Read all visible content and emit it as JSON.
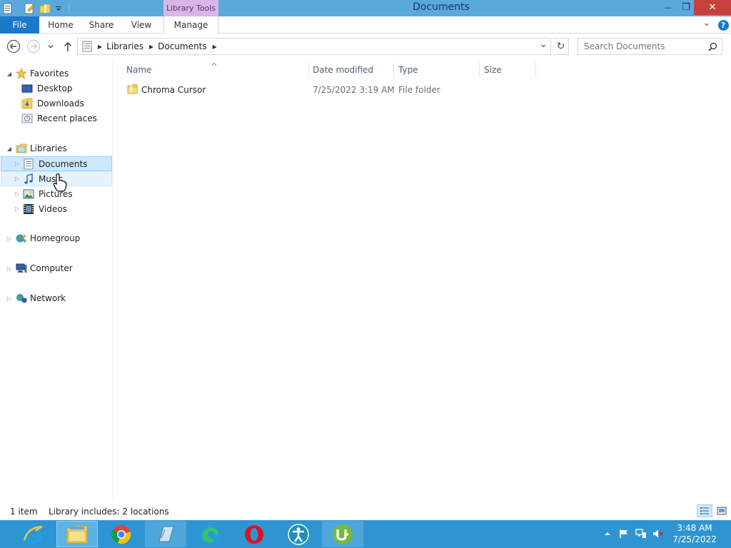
{
  "window": {
    "title": "Documents",
    "contextual_tab_group": "Library Tools",
    "minimize_glyph": "—",
    "restore_glyph": "❐",
    "close_glyph": "✕"
  },
  "ribbon": {
    "tabs": [
      {
        "label": "File"
      },
      {
        "label": "Home"
      },
      {
        "label": "Share"
      },
      {
        "label": "View"
      },
      {
        "label": "Manage"
      }
    ],
    "expand_glyph": "⌄",
    "help_glyph": "?"
  },
  "address": {
    "crumbs": [
      "Libraries",
      "Documents"
    ],
    "dropdown_glyph": "⌄",
    "refresh_glyph": "↻"
  },
  "search": {
    "placeholder": "Search Documents"
  },
  "nav_pane": {
    "favorites": {
      "label": "Favorites",
      "items": [
        {
          "label": "Desktop"
        },
        {
          "label": "Downloads"
        },
        {
          "label": "Recent places"
        }
      ]
    },
    "libraries": {
      "label": "Libraries",
      "items": [
        {
          "label": "Documents"
        },
        {
          "label": "Music"
        },
        {
          "label": "Pictures"
        },
        {
          "label": "Videos"
        }
      ]
    },
    "homegroup": {
      "label": "Homegroup"
    },
    "computer": {
      "label": "Computer"
    },
    "network": {
      "label": "Network"
    }
  },
  "file_list": {
    "columns": [
      {
        "label": "Name"
      },
      {
        "label": "Date modified"
      },
      {
        "label": "Type"
      },
      {
        "label": "Size"
      }
    ],
    "rows": [
      {
        "name": "Chroma Cursor",
        "date_modified": "7/25/2022 3:19 AM",
        "type": "File folder",
        "size": ""
      }
    ]
  },
  "status_bar": {
    "item_count": "1 item",
    "library_info": "Library includes: 2 locations"
  },
  "taskbar": {
    "apps": [
      {
        "icon": "internet-explorer-icon"
      },
      {
        "icon": "file-explorer-icon"
      },
      {
        "icon": "chrome-icon"
      },
      {
        "icon": "notepad-app-icon"
      },
      {
        "icon": "edge-icon"
      },
      {
        "icon": "opera-icon"
      },
      {
        "icon": "accessibility-app-icon"
      },
      {
        "icon": "utorrent-icon"
      }
    ],
    "clock_time": "3:48 AM",
    "clock_date": "7/25/2022"
  },
  "colors": {
    "titlebar": "#5aa9dd",
    "file_tab": "#1979ca",
    "library_tools": "#d8b7e8",
    "selection": "#cce8ff",
    "taskbar": "#2f95d2",
    "close_button": "#c7413a"
  }
}
